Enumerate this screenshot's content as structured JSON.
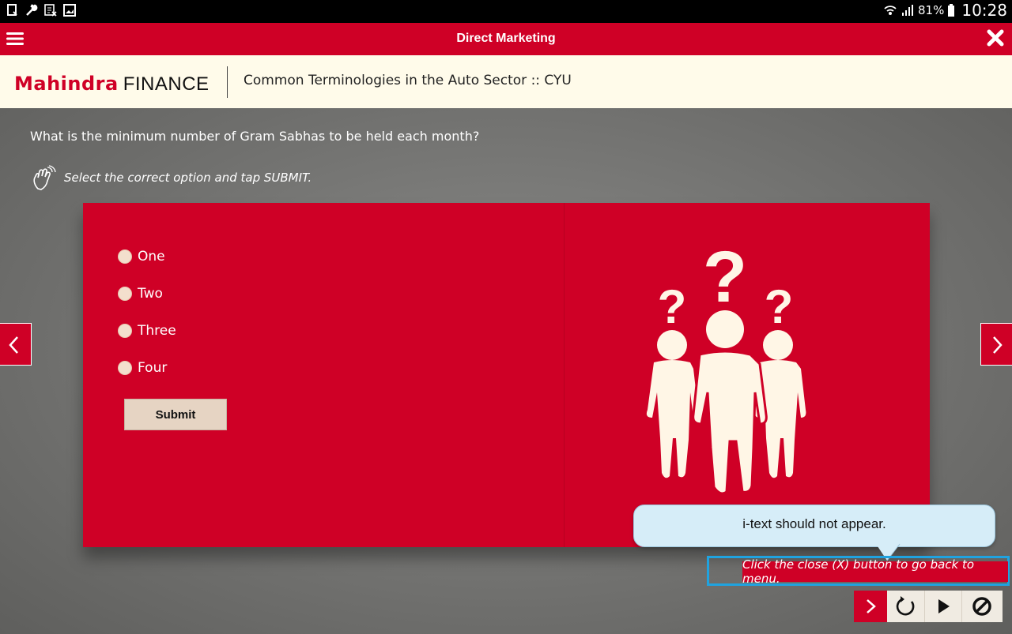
{
  "status_bar": {
    "battery_percent": "81%",
    "time": "10:28",
    "left_icons": [
      "screenshot-icon",
      "wrench-icon",
      "excel-icon",
      "gallery-icon"
    ],
    "right_icons": [
      "wifi-icon",
      "signal-icon",
      "battery-icon"
    ]
  },
  "title_bar": {
    "title": "Direct Marketing",
    "background": "#cf0026"
  },
  "header": {
    "logo_brand": "Mahindra",
    "logo_finance": "FINANCE",
    "course_title": "Common Terminologies in the Auto Sector :: CYU"
  },
  "quiz": {
    "question": "What is the minimum number of Gram Sabhas to be held each month?",
    "instruction": "Select the correct option and tap SUBMIT.",
    "options": [
      "One",
      "Two",
      "Three",
      "Four"
    ],
    "submit_label": "Submit"
  },
  "annotation": {
    "callout_text": "i-text should not appear.",
    "hint_text": "Click the close (X) button to go back to menu."
  },
  "colors": {
    "accent": "#cf0026",
    "header_bg": "#fffbea",
    "callout_bg": "#d6edf8",
    "highlight_border": "#1fa3e0"
  }
}
